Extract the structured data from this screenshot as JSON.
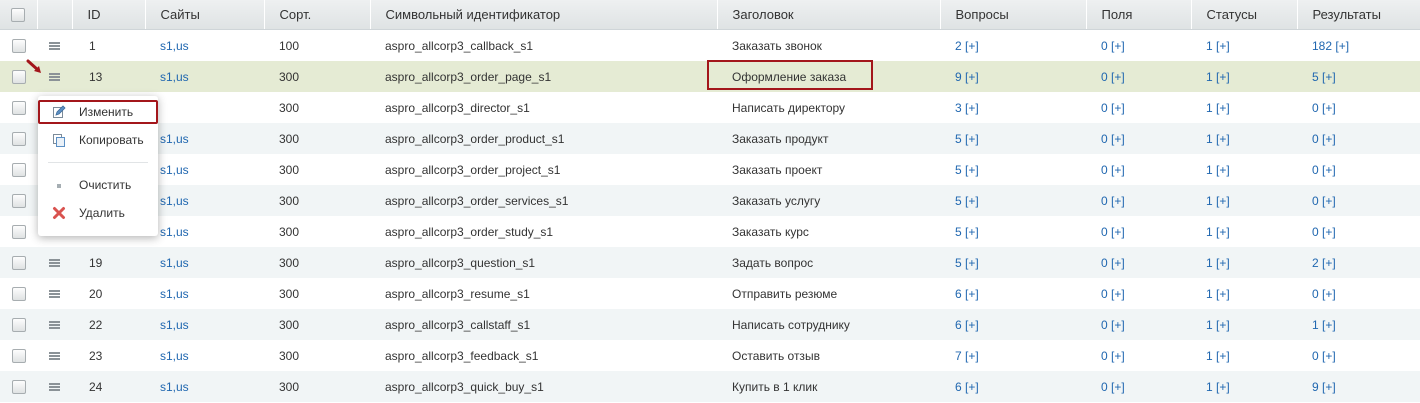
{
  "table": {
    "columns": [
      "ID",
      "Сайты",
      "Сорт.",
      "Символьный идентификатор",
      "Заголовок",
      "Вопросы",
      "Поля",
      "Статусы",
      "Результаты"
    ],
    "rows": [
      {
        "id": "1",
        "sites": "s1,us",
        "sort": "100",
        "sid": "aspro_allcorp3_callback_s1",
        "title": "Заказать звонок",
        "questions": "2",
        "fields": "0",
        "statuses": "1",
        "results": "182"
      },
      {
        "id": "13",
        "sites": "s1,us",
        "sort": "300",
        "sid": "aspro_allcorp3_order_page_s1",
        "title": "Оформление заказа",
        "questions": "9",
        "fields": "0",
        "statuses": "1",
        "results": "5"
      },
      {
        "id": "",
        "sites": "",
        "sort": "300",
        "sid": "aspro_allcorp3_director_s1",
        "title": "Написать директору",
        "questions": "3",
        "fields": "0",
        "statuses": "1",
        "results": "0"
      },
      {
        "id": "",
        "sites": "s1,us",
        "sort": "300",
        "sid": "aspro_allcorp3_order_product_s1",
        "title": "Заказать продукт",
        "questions": "5",
        "fields": "0",
        "statuses": "1",
        "results": "0"
      },
      {
        "id": "",
        "sites": "s1,us",
        "sort": "300",
        "sid": "aspro_allcorp3_order_project_s1",
        "title": "Заказать проект",
        "questions": "5",
        "fields": "0",
        "statuses": "1",
        "results": "0"
      },
      {
        "id": "",
        "sites": "s1,us",
        "sort": "300",
        "sid": "aspro_allcorp3_order_services_s1",
        "title": "Заказать услугу",
        "questions": "5",
        "fields": "0",
        "statuses": "1",
        "results": "0"
      },
      {
        "id": "",
        "sites": "s1,us",
        "sort": "300",
        "sid": "aspro_allcorp3_order_study_s1",
        "title": "Заказать курс",
        "questions": "5",
        "fields": "0",
        "statuses": "1",
        "results": "0"
      },
      {
        "id": "19",
        "sites": "s1,us",
        "sort": "300",
        "sid": "aspro_allcorp3_question_s1",
        "title": "Задать вопрос",
        "questions": "5",
        "fields": "0",
        "statuses": "1",
        "results": "2"
      },
      {
        "id": "20",
        "sites": "s1,us",
        "sort": "300",
        "sid": "aspro_allcorp3_resume_s1",
        "title": "Отправить резюме",
        "questions": "6",
        "fields": "0",
        "statuses": "1",
        "results": "0"
      },
      {
        "id": "22",
        "sites": "s1,us",
        "sort": "300",
        "sid": "aspro_allcorp3_callstaff_s1",
        "title": "Написать сотруднику",
        "questions": "6",
        "fields": "0",
        "statuses": "1",
        "results": "1"
      },
      {
        "id": "23",
        "sites": "s1,us",
        "sort": "300",
        "sid": "aspro_allcorp3_feedback_s1",
        "title": "Оставить отзыв",
        "questions": "7",
        "fields": "0",
        "statuses": "1",
        "results": "0"
      },
      {
        "id": "24",
        "sites": "s1,us",
        "sort": "300",
        "sid": "aspro_allcorp3_quick_buy_s1",
        "title": "Купить в 1 клик",
        "questions": "6",
        "fields": "0",
        "statuses": "1",
        "results": "9"
      }
    ],
    "add_label": "[+]",
    "selected_row_index": 1
  },
  "context_menu": {
    "items": [
      {
        "label": "Изменить",
        "icon": "edit-icon"
      },
      {
        "label": "Копировать",
        "icon": "copy-icon"
      },
      {
        "label": "Очистить",
        "icon": "dot-icon"
      },
      {
        "label": "Удалить",
        "icon": "delete-icon"
      }
    ],
    "highlighted_index": 0
  },
  "colors": {
    "link": "#2067b0",
    "selected_row": "#e5ebd4",
    "highlight_border": "#a3161b",
    "delete_red": "#d9534f"
  }
}
